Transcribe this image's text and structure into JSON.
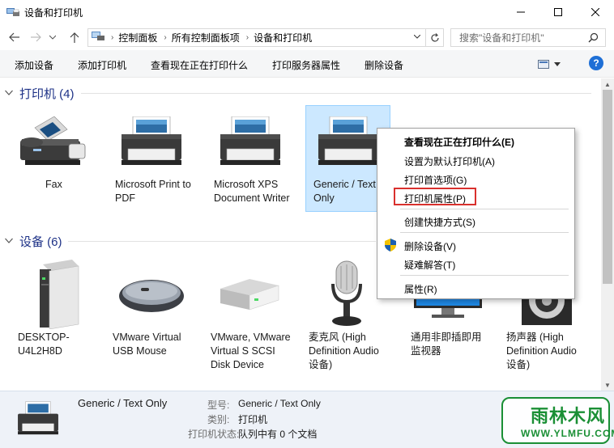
{
  "window": {
    "title": "设备和打印机",
    "icon": "devices-printers-icon"
  },
  "nav": {
    "breadcrumbs": [
      "控制面板",
      "所有控制面板项",
      "设备和打印机"
    ],
    "search_placeholder": "搜索\"设备和打印机\""
  },
  "toolbar": {
    "add_device": "添加设备",
    "add_printer": "添加打印机",
    "see_printing": "查看现在正在打印什么",
    "print_server_props": "打印服务器属性",
    "remove_device": "删除设备",
    "help": "?"
  },
  "groups": {
    "printers": {
      "title": "打印机 (4)",
      "items": [
        {
          "label": "Fax",
          "icon": "fax-icon"
        },
        {
          "label": "Microsoft Print to PDF",
          "icon": "printer-icon"
        },
        {
          "label": "Microsoft XPS Document Writer",
          "icon": "printer-icon"
        },
        {
          "label": "Generic / Text Only",
          "icon": "printer-icon",
          "selected": true
        }
      ]
    },
    "devices": {
      "title": "设备 (6)",
      "items": [
        {
          "label": "DESKTOP-U4L2H8D",
          "icon": "computer-tower-icon"
        },
        {
          "label": "VMware Virtual USB Mouse",
          "icon": "mouse-icon"
        },
        {
          "label": "VMware, VMware Virtual S SCSI Disk Device",
          "icon": "disk-drive-icon"
        },
        {
          "label": "麦克风 (High Definition Audio 设备)",
          "icon": "microphone-icon"
        },
        {
          "label": "通用非即插即用监视器",
          "icon": "monitor-icon"
        },
        {
          "label": "扬声器 (High Definition Audio 设备)",
          "icon": "speaker-icon"
        }
      ]
    }
  },
  "context_menu": {
    "items": [
      {
        "label": "查看现在正在打印什么(E)",
        "bold": true
      },
      {
        "label": "设置为默认打印机(A)"
      },
      {
        "label": "打印首选项(G)"
      },
      {
        "label": "打印机属性(P)",
        "highlighted": true
      },
      {
        "label": "创建快捷方式(S)"
      },
      {
        "label": "删除设备(V)",
        "icon": "shield-icon"
      },
      {
        "label": "疑难解答(T)"
      },
      {
        "label": "属性(R)"
      }
    ]
  },
  "details": {
    "name": "Generic / Text Only",
    "model_label": "型号:",
    "model_value": "Generic / Text Only",
    "category_label": "类别:",
    "category_value": "打印机",
    "status_label": "打印机状态:",
    "status_value": "队列中有 0 个文档"
  },
  "watermark": {
    "title": "雨林木风",
    "url": "WWW.YLMFU.COM"
  },
  "colors": {
    "accent_blue": "#1e3287",
    "selection": "#cce8ff",
    "highlight_red": "#d9302d",
    "watermark_green": "#1a8f35"
  }
}
